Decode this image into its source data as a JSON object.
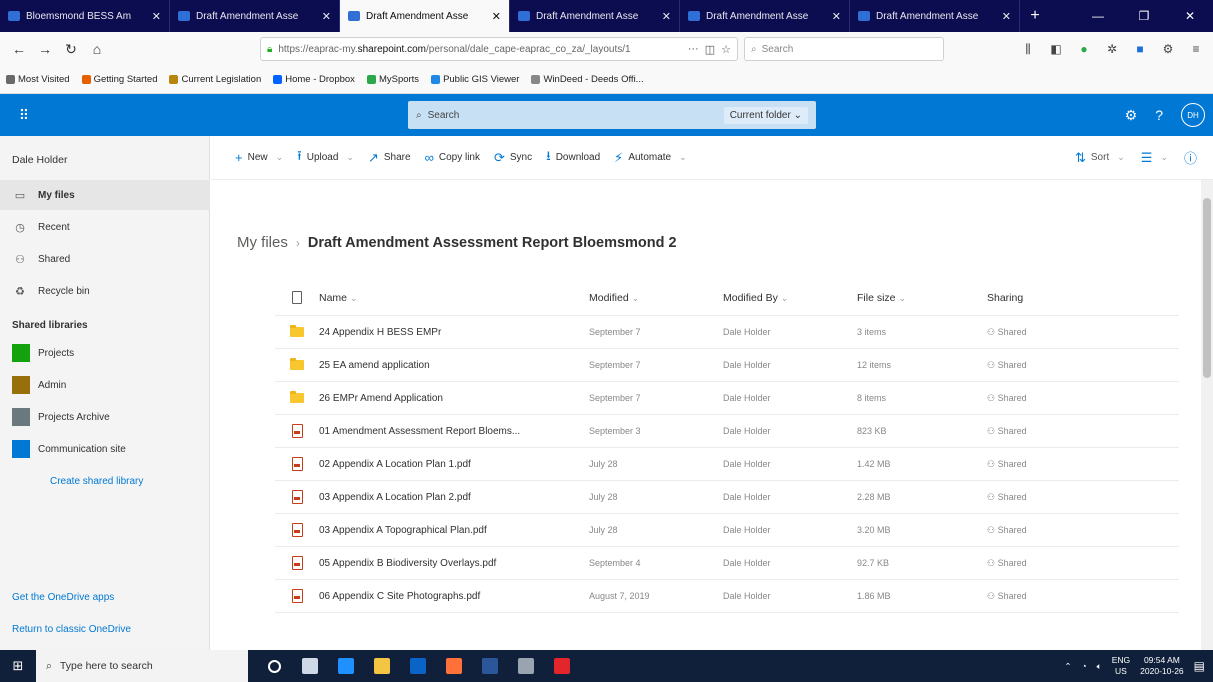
{
  "browser": {
    "tabs": [
      {
        "title": "Bloemsmond BESS Am",
        "active": false
      },
      {
        "title": "Draft Amendment Asse",
        "active": false
      },
      {
        "title": "Draft Amendment Asse",
        "active": true
      },
      {
        "title": "Draft Amendment Asse",
        "active": false
      },
      {
        "title": "Draft Amendment Asse",
        "active": false
      },
      {
        "title": "Draft Amendment Asse",
        "active": false
      }
    ],
    "url_prefix": "https://eaprac-my.",
    "url_domain": "sharepoint.com",
    "url_rest": "/personal/dale_cape-eaprac_co_za/_layouts/1",
    "search_placeholder": "Search",
    "bookmarks": [
      {
        "label": "Most Visited",
        "color": "#6a6a6a"
      },
      {
        "label": "Getting Started",
        "color": "#e66000"
      },
      {
        "label": "Current Legislation",
        "color": "#b8860b"
      },
      {
        "label": "Home - Dropbox",
        "color": "#0061fe"
      },
      {
        "label": "MySports",
        "color": "#2ba84a"
      },
      {
        "label": "Public GIS Viewer",
        "color": "#1e88e5"
      },
      {
        "label": "WinDeed - Deeds Offi...",
        "color": "#888888"
      }
    ]
  },
  "suite": {
    "search_placeholder": "Search",
    "scope_label": "Current folder",
    "avatar_initials": "DH"
  },
  "leftnav": {
    "user_name": "Dale Holder",
    "items": [
      {
        "label": "My files",
        "icon": "folder",
        "selected": true
      },
      {
        "label": "Recent",
        "icon": "clock",
        "selected": false
      },
      {
        "label": "Shared",
        "icon": "people",
        "selected": false
      },
      {
        "label": "Recycle bin",
        "icon": "recycle",
        "selected": false
      }
    ],
    "shared_header": "Shared libraries",
    "libraries": [
      {
        "label": "Projects",
        "color": "#13a10e"
      },
      {
        "label": "Admin",
        "color": "#986f0b"
      },
      {
        "label": "Projects Archive",
        "color": "#69797e"
      },
      {
        "label": "Communication site",
        "color": "#0078d4"
      }
    ],
    "create_label": "Create shared library",
    "get_apps": "Get the OneDrive apps",
    "return_classic": "Return to classic OneDrive"
  },
  "commands": {
    "new": "New",
    "upload": "Upload",
    "share": "Share",
    "copy_link": "Copy link",
    "sync": "Sync",
    "download": "Download",
    "automate": "Automate",
    "sort": "Sort"
  },
  "breadcrumb": {
    "root": "My files",
    "current": "Draft Amendment Assessment Report Bloemsmond 2"
  },
  "columns": {
    "name": "Name",
    "modified": "Modified",
    "modified_by": "Modified By",
    "file_size": "File size",
    "sharing": "Sharing"
  },
  "files": [
    {
      "type": "folder",
      "name": "24 Appendix H BESS EMPr",
      "modified": "September 7",
      "by": "Dale Holder",
      "size": "3 items",
      "sharing": "Shared"
    },
    {
      "type": "folder",
      "name": "25 EA amend application",
      "modified": "September 7",
      "by": "Dale Holder",
      "size": "12 items",
      "sharing": "Shared"
    },
    {
      "type": "folder",
      "name": "26 EMPr Amend Application",
      "modified": "September 7",
      "by": "Dale Holder",
      "size": "8 items",
      "sharing": "Shared"
    },
    {
      "type": "pdf",
      "name": "01 Amendment Assessment Report Bloems...",
      "modified": "September 3",
      "by": "Dale Holder",
      "size": "823 KB",
      "sharing": "Shared"
    },
    {
      "type": "pdf",
      "name": "02 Appendix A Location Plan 1.pdf",
      "modified": "July 28",
      "by": "Dale Holder",
      "size": "1.42 MB",
      "sharing": "Shared"
    },
    {
      "type": "pdf",
      "name": "03 Appendix A Location Plan 2.pdf",
      "modified": "July 28",
      "by": "Dale Holder",
      "size": "2.28 MB",
      "sharing": "Shared"
    },
    {
      "type": "pdf",
      "name": "03 Appendix A Topographical Plan.pdf",
      "modified": "July 28",
      "by": "Dale Holder",
      "size": "3.20 MB",
      "sharing": "Shared"
    },
    {
      "type": "pdf",
      "name": "05 Appendix B Biodiversity Overlays.pdf",
      "modified": "September 4",
      "by": "Dale Holder",
      "size": "92.7 KB",
      "sharing": "Shared"
    },
    {
      "type": "pdf",
      "name": "06 Appendix C Site Photographs.pdf",
      "modified": "August 7, 2019",
      "by": "Dale Holder",
      "size": "1.86 MB",
      "sharing": "Shared"
    }
  ],
  "taskbar": {
    "search_placeholder": "Type here to search",
    "apps": [
      {
        "name": "cortana",
        "color": "#ffffff"
      },
      {
        "name": "task-view",
        "color": "#cfd8e6"
      },
      {
        "name": "edge",
        "color": "#1e90ff"
      },
      {
        "name": "file-explorer",
        "color": "#f4c542"
      },
      {
        "name": "outlook",
        "color": "#0a64c8"
      },
      {
        "name": "firefox",
        "color": "#ff7139"
      },
      {
        "name": "word",
        "color": "#2b579a"
      },
      {
        "name": "app",
        "color": "#9aa4b0"
      },
      {
        "name": "acrobat",
        "color": "#e3252c"
      }
    ],
    "lang_top": "ENG",
    "lang_bottom": "US",
    "time": "09:54 AM",
    "date": "2020-10-26"
  }
}
